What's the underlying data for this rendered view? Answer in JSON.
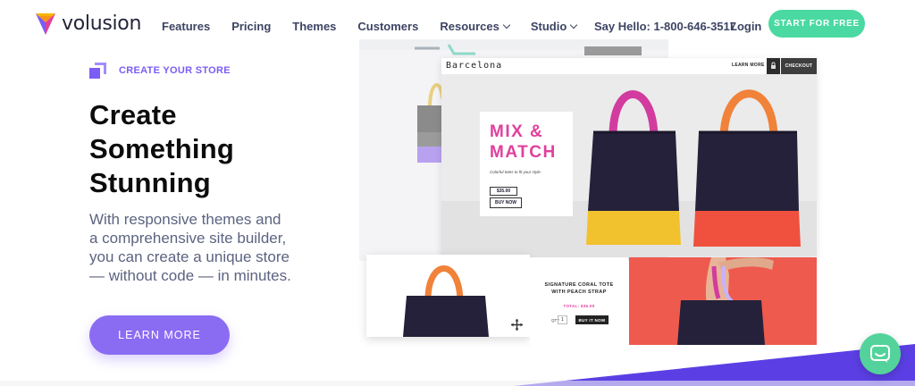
{
  "nav": {
    "logo_text": "volusion",
    "menu": [
      {
        "label": "Features",
        "dropdown": false
      },
      {
        "label": "Pricing",
        "dropdown": false
      },
      {
        "label": "Themes",
        "dropdown": false
      },
      {
        "label": "Customers",
        "dropdown": false
      },
      {
        "label": "Resources",
        "dropdown": true
      },
      {
        "label": "Studio",
        "dropdown": true
      }
    ],
    "say_hello": "Say Hello:  1-800-646-3517",
    "login": "Login",
    "cta": "START FOR FREE"
  },
  "hero": {
    "eyebrow": "CREATE YOUR STORE",
    "headline": "Create\nSomething\nStunning",
    "subtext": "With responsive themes and\na comprehensive site builder,\nyou can create a unique store\n— without code — in minutes.",
    "button": "LEARN MORE"
  },
  "preview": {
    "brand": "Barcelona",
    "learn_more": "LEARN MORE",
    "checkout": "CHECKOUT",
    "promo_title": "MIX &\nMATCH",
    "promo_sub": "Colorful totes to fit your style.",
    "promo_price": "$35.00",
    "promo_buy": "BUY NOW",
    "product_title": "SIGNATURE CORAL TOTE\nWITH PEACH STRAP",
    "product_total": "TOTAL: $35.00",
    "qty_label": "QTY",
    "qty_value": "1",
    "product_buy": "BUY IT NOW"
  },
  "colors": {
    "brand_purple": "#7c5cf5",
    "cta_green": "#49d9a1",
    "promo_pink": "#e0409d",
    "coral": "#ee5a4e",
    "tote_navy": "#25213a",
    "tote_yellow": "#f2c12e",
    "chat_green": "#53d39b"
  },
  "icons": {
    "logo": "volusion-logo-icon",
    "eyebrow": "store-layers-icon",
    "move": "move-arrows-icon",
    "chat": "chat-bubble-icon"
  }
}
